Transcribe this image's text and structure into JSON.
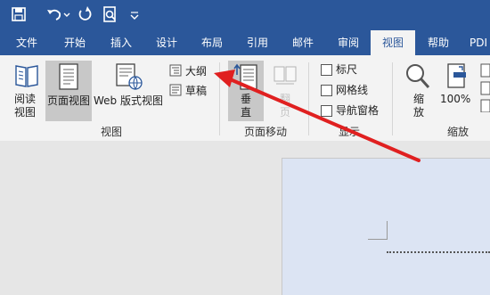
{
  "quick_access": {
    "icons": [
      "save-icon",
      "undo-icon",
      "redo-icon",
      "print-preview-icon",
      "customize-dropdown-icon"
    ]
  },
  "tabs": [
    {
      "label": "文件"
    },
    {
      "label": "开始"
    },
    {
      "label": "插入"
    },
    {
      "label": "设计"
    },
    {
      "label": "布局"
    },
    {
      "label": "引用"
    },
    {
      "label": "邮件"
    },
    {
      "label": "审阅"
    },
    {
      "label": "视图",
      "active": true
    },
    {
      "label": "帮助"
    },
    {
      "label": "PDI"
    }
  ],
  "ribbon": {
    "views": {
      "read_mode": "阅读\n视图",
      "print_layout": "页面视图",
      "web_layout": "Web 版式视图",
      "outline": "大纲",
      "draft": "草稿",
      "group_label": "视图"
    },
    "page_movement": {
      "vertical": "垂\n直",
      "side_to_side": "翻\n页",
      "group_label": "页面移动"
    },
    "show": {
      "ruler": "标尺",
      "gridlines": "网格线",
      "nav_pane": "导航窗格",
      "group_label": "显示"
    },
    "zoom": {
      "zoom": "缩\n放",
      "percent": "100%",
      "group_label": "缩放"
    }
  },
  "colors": {
    "brand": "#2b579a",
    "ribbon_bg": "#f3f3f3",
    "selected_bg": "#c8c8c8",
    "annotation_arrow": "#e02020"
  }
}
